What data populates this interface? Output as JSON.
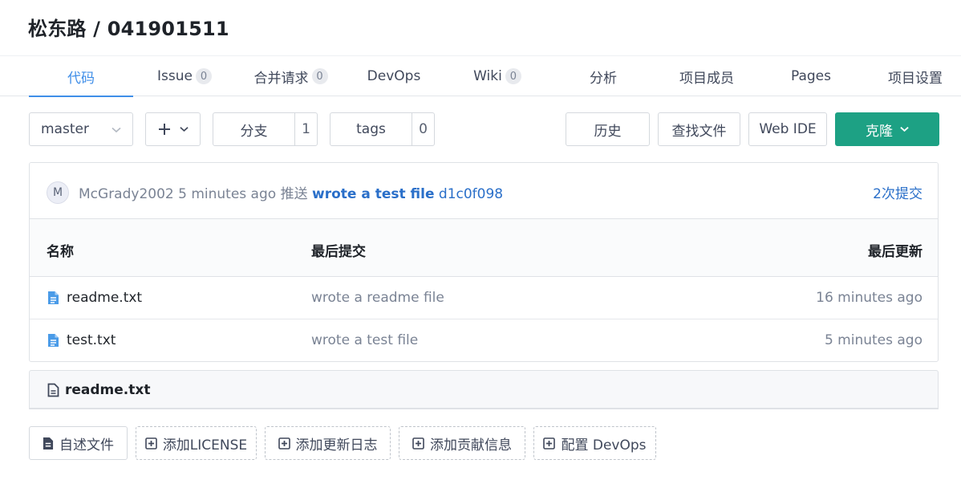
{
  "repo": {
    "owner": "松东路",
    "separator": "/",
    "name": "041901511"
  },
  "tabs": [
    {
      "label": "代码",
      "active": true
    },
    {
      "label": "Issue",
      "badge": "0"
    },
    {
      "label": "合并请求",
      "badge": "0"
    },
    {
      "label": "DevOps"
    },
    {
      "label": "Wiki",
      "badge": "0"
    },
    {
      "label": "分析"
    },
    {
      "label": "项目成员"
    },
    {
      "label": "Pages"
    },
    {
      "label": "项目设置"
    }
  ],
  "toolbar": {
    "branch": "master",
    "branches_label": "分支",
    "branches_count": "1",
    "tags_label": "tags",
    "tags_count": "0",
    "history": "历史",
    "find_file": "查找文件",
    "web_ide": "Web IDE",
    "clone": "克隆"
  },
  "commit": {
    "avatar_letter": "M",
    "author": "McGrady2002",
    "time": "5 minutes ago",
    "action": "推送",
    "message": "wrote a test file",
    "hash": "d1c0f098",
    "count_label": "2次提交"
  },
  "table": {
    "headers": [
      "名称",
      "最后提交",
      "最后更新"
    ],
    "rows": [
      {
        "name": "readme.txt",
        "message": "wrote a readme file",
        "updated": "16 minutes ago"
      },
      {
        "name": "test.txt",
        "message": "wrote a test file",
        "updated": "5 minutes ago"
      }
    ]
  },
  "readme": {
    "filename": "readme.txt"
  },
  "actions": [
    "自述文件",
    "添加LICENSE",
    "添加更新日志",
    "添加贡献信息",
    "配置 DevOps"
  ],
  "colors": {
    "accent": "#3f8ee8",
    "clone": "#1da184",
    "link": "#2a6fc9"
  }
}
